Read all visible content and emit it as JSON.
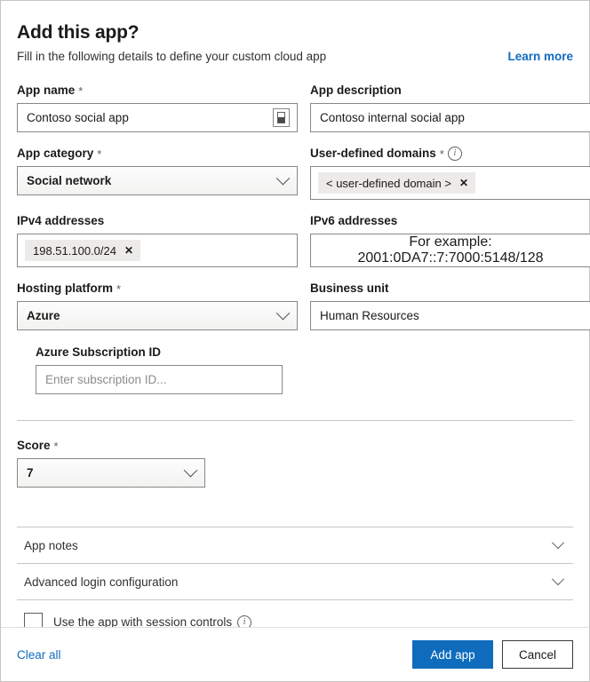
{
  "header": {
    "title": "Add this app?",
    "subtitle": "Fill in the following details to define your custom cloud app",
    "learn_more": "Learn more"
  },
  "fields": {
    "app_name": {
      "label": "App name",
      "required": "*",
      "value": "Contoso social app",
      "trailing_icon": "insert-icon"
    },
    "app_description": {
      "label": "App description",
      "value": "Contoso internal social app"
    },
    "app_category": {
      "label": "App category",
      "required": "*",
      "value": "Social network"
    },
    "user_defined_domains": {
      "label": "User-defined domains",
      "required": "*",
      "info": "i",
      "chips": [
        "< user-defined domain >"
      ],
      "chip_remove": "✕"
    },
    "ipv4_addresses": {
      "label": "IPv4 addresses",
      "chips": [
        "198.51.100.0/24"
      ],
      "chip_remove": "✕"
    },
    "ipv6_addresses": {
      "label": "IPv6 addresses",
      "placeholder": "For example: 2001:0DA7::7:7000:5148/128"
    },
    "hosting_platform": {
      "label": "Hosting platform",
      "required": "*",
      "value": "Azure"
    },
    "business_unit": {
      "label": "Business unit",
      "value": "Human Resources"
    },
    "azure_subscription_id": {
      "label": "Azure Subscription ID",
      "placeholder": "Enter subscription ID..."
    },
    "score": {
      "label": "Score",
      "required": "*",
      "value": "7"
    }
  },
  "accordions": [
    {
      "label": "App notes"
    },
    {
      "label": "Advanced login configuration"
    }
  ],
  "session_controls": {
    "label": "Use the app with session controls",
    "info": "i",
    "checked": false
  },
  "footer": {
    "clear_all": "Clear all",
    "add_app": "Add app",
    "cancel": "Cancel"
  },
  "colors": {
    "accent": "#0f6cbd",
    "text": "#1b1a19",
    "border": "#8a8886",
    "chip_bg": "#edebe9"
  }
}
